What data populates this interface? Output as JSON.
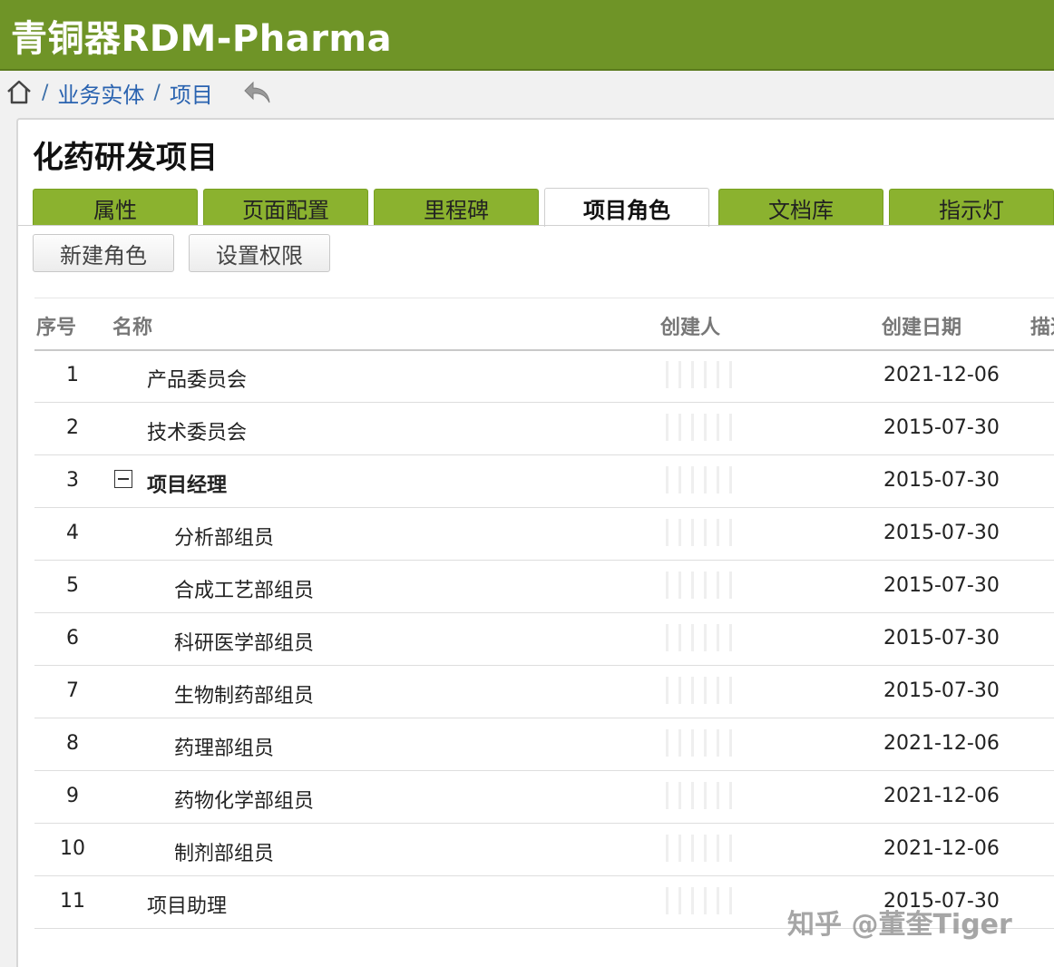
{
  "app": {
    "title": "青铜器RDM-Pharma"
  },
  "breadcrumb": {
    "sep": "/",
    "items": [
      "业务实体",
      "项目"
    ]
  },
  "page": {
    "title": "化药研发项目"
  },
  "tabs": [
    {
      "label": "属性",
      "active": false
    },
    {
      "label": "页面配置",
      "active": false
    },
    {
      "label": "里程碑",
      "active": false
    },
    {
      "label": "项目角色",
      "active": true
    },
    {
      "label": "文档库",
      "active": false
    },
    {
      "label": "指示灯",
      "active": false
    }
  ],
  "toolbar": {
    "new_role": "新建角色",
    "set_permission": "设置权限"
  },
  "table": {
    "headers": {
      "no": "序号",
      "name": "名称",
      "creator": "创建人",
      "date": "创建日期",
      "desc": "描述"
    },
    "rows": [
      {
        "no": "1",
        "name": "产品委员会",
        "level": 1,
        "date": "2021-12-06"
      },
      {
        "no": "2",
        "name": "技术委员会",
        "level": 1,
        "date": "2015-07-30"
      },
      {
        "no": "3",
        "name": "项目经理",
        "level": 1,
        "date": "2015-07-30",
        "expanded": true
      },
      {
        "no": "4",
        "name": "分析部组员",
        "level": 2,
        "date": "2015-07-30"
      },
      {
        "no": "5",
        "name": "合成工艺部组员",
        "level": 2,
        "date": "2015-07-30"
      },
      {
        "no": "6",
        "name": "科研医学部组员",
        "level": 2,
        "date": "2015-07-30"
      },
      {
        "no": "7",
        "name": "生物制药部组员",
        "level": 2,
        "date": "2015-07-30"
      },
      {
        "no": "8",
        "name": "药理部组员",
        "level": 2,
        "date": "2021-12-06"
      },
      {
        "no": "9",
        "name": "药物化学部组员",
        "level": 2,
        "date": "2021-12-06"
      },
      {
        "no": "10",
        "name": "制剂部组员",
        "level": 2,
        "date": "2021-12-06"
      },
      {
        "no": "11",
        "name": "项目助理",
        "level": 1,
        "date": "2015-07-30"
      }
    ]
  },
  "watermark": "知乎 @董奎Tiger",
  "colors": {
    "brand": "#6f9427",
    "tab": "#8bb22f",
    "link": "#2a63b0"
  }
}
